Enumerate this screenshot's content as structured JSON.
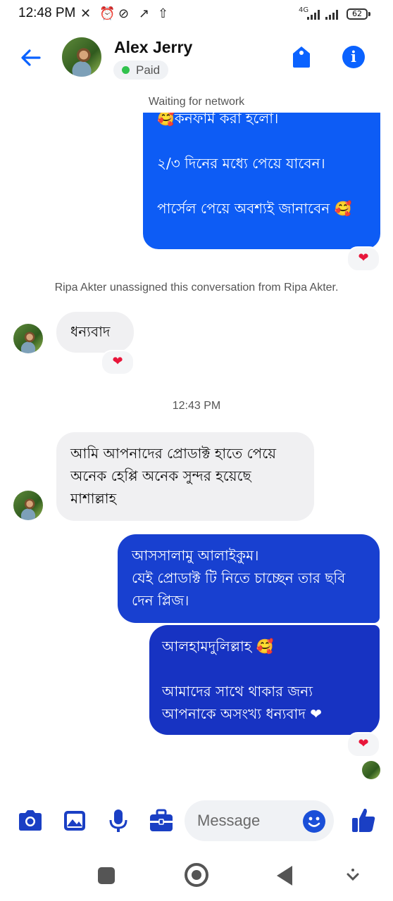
{
  "status_bar": {
    "time": "12:48 PM",
    "network": "4G",
    "battery": "62"
  },
  "header": {
    "contact_name": "Alex Jerry",
    "badge": "Paid",
    "network_status": "Waiting for network"
  },
  "messages": [
    {
      "direction": "outgoing",
      "text": "🥰কনফার্ম করা হলো।\n\n২/৩ দিনের মধ্যে পেয়ে যাবেন।\n\nপার্সেল পেয়ে অবশ্যই জানাবেন 🥰",
      "reaction": "❤"
    },
    {
      "direction": "system",
      "text": "Ripa Akter unassigned this conversation from Ripa Akter."
    },
    {
      "direction": "incoming",
      "text": "ধন্যবাদ",
      "reaction": "❤"
    },
    {
      "direction": "timestamp",
      "text": "12:43 PM"
    },
    {
      "direction": "incoming",
      "text": "আমি আপনাদের প্রোডাক্ট হাতে পেয়ে অনেক হেপ্পি অনেক সুন্দর হয়েছে মাশাল্লাহ"
    },
    {
      "direction": "outgoing",
      "text": "আসসালামু আলাইকুম।\nযেই প্রোডাক্ট টি নিতে চাচ্ছেন তার ছবি দেন প্লিজ।"
    },
    {
      "direction": "outgoing",
      "text": "আলহামদুলিল্লাহ 🥰\n\nআমাদের সাথে থাকার জন্য আপনাকে অসংখ্য ধন্যবাদ ❤",
      "reaction": "❤"
    }
  ],
  "composer": {
    "placeholder": "Message"
  },
  "icons": {
    "back": "arrow-left-icon",
    "tag": "tag-icon",
    "info": "info-icon",
    "camera": "camera-icon",
    "gallery": "image-icon",
    "mic": "microphone-icon",
    "briefcase": "briefcase-icon",
    "emoji": "emoji-icon",
    "like": "thumbs-up-icon"
  },
  "colors": {
    "accent": "#0a62ff",
    "outgoing_bubble": "#0d5cf5",
    "incoming_bubble": "#f0f0f2",
    "online": "#31c24d",
    "heart": "#e8163a"
  }
}
